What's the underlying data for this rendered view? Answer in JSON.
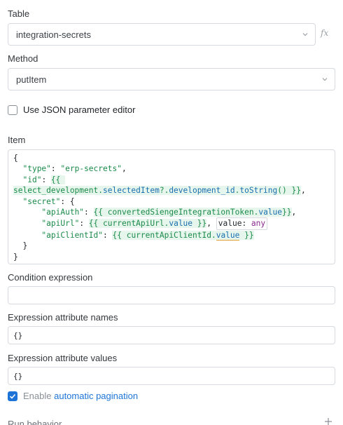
{
  "table": {
    "label": "Table",
    "value": "integration-secrets",
    "fx": "fx"
  },
  "method": {
    "label": "Method",
    "value": "putItem"
  },
  "json_editor": {
    "label": "Use JSON parameter editor",
    "checked": false
  },
  "item": {
    "label": "Item",
    "code_lines": {
      "l1": "{",
      "l2_key": "\"type\"",
      "l2_val": "\"erp-secrets\"",
      "l3_key": "\"id\"",
      "l3_open": "{{",
      "l4_obj": "select_development",
      "l4_p1": "selectedItem",
      "l4_opt": "?.",
      "l4_p2": "development_id",
      "l4_p3": "toString",
      "l4_call": "()",
      "l4_close": "}}",
      "l5_key": "\"secret\"",
      "l6_key": "\"apiAuth\"",
      "l6_open": "{{",
      "l6_obj": "convertedSiengeIntegrationToken",
      "l6_prop": "value",
      "l6_close": "}}",
      "l7_key": "\"apiUrl\"",
      "l7_open": "{{",
      "l7_obj": "currentApiUrl",
      "l7_prop": "value",
      "l7_close": "}}",
      "l7_hint_name": "value",
      "l7_hint_type": "any",
      "l8_key": "\"apiClientId\"",
      "l8_open": "{{",
      "l8_obj": "currentApiClientId",
      "l8_prop": "value",
      "l8_close": "}}",
      "l9": "}",
      "l10": "}"
    }
  },
  "condition_expression": {
    "label": "Condition expression",
    "value": ""
  },
  "attr_names": {
    "label": "Expression attribute names",
    "value": "{}"
  },
  "attr_values": {
    "label": "Expression attribute values",
    "value": "{}"
  },
  "pagination": {
    "label_prefix": "Enable",
    "label_link": "automatic pagination",
    "checked": true
  },
  "run_behavior": {
    "label": "Run behavior"
  },
  "colors": {
    "accent": "#1d74d6",
    "template_bg": "#e7f6ec",
    "string": "#1a8a4a"
  }
}
